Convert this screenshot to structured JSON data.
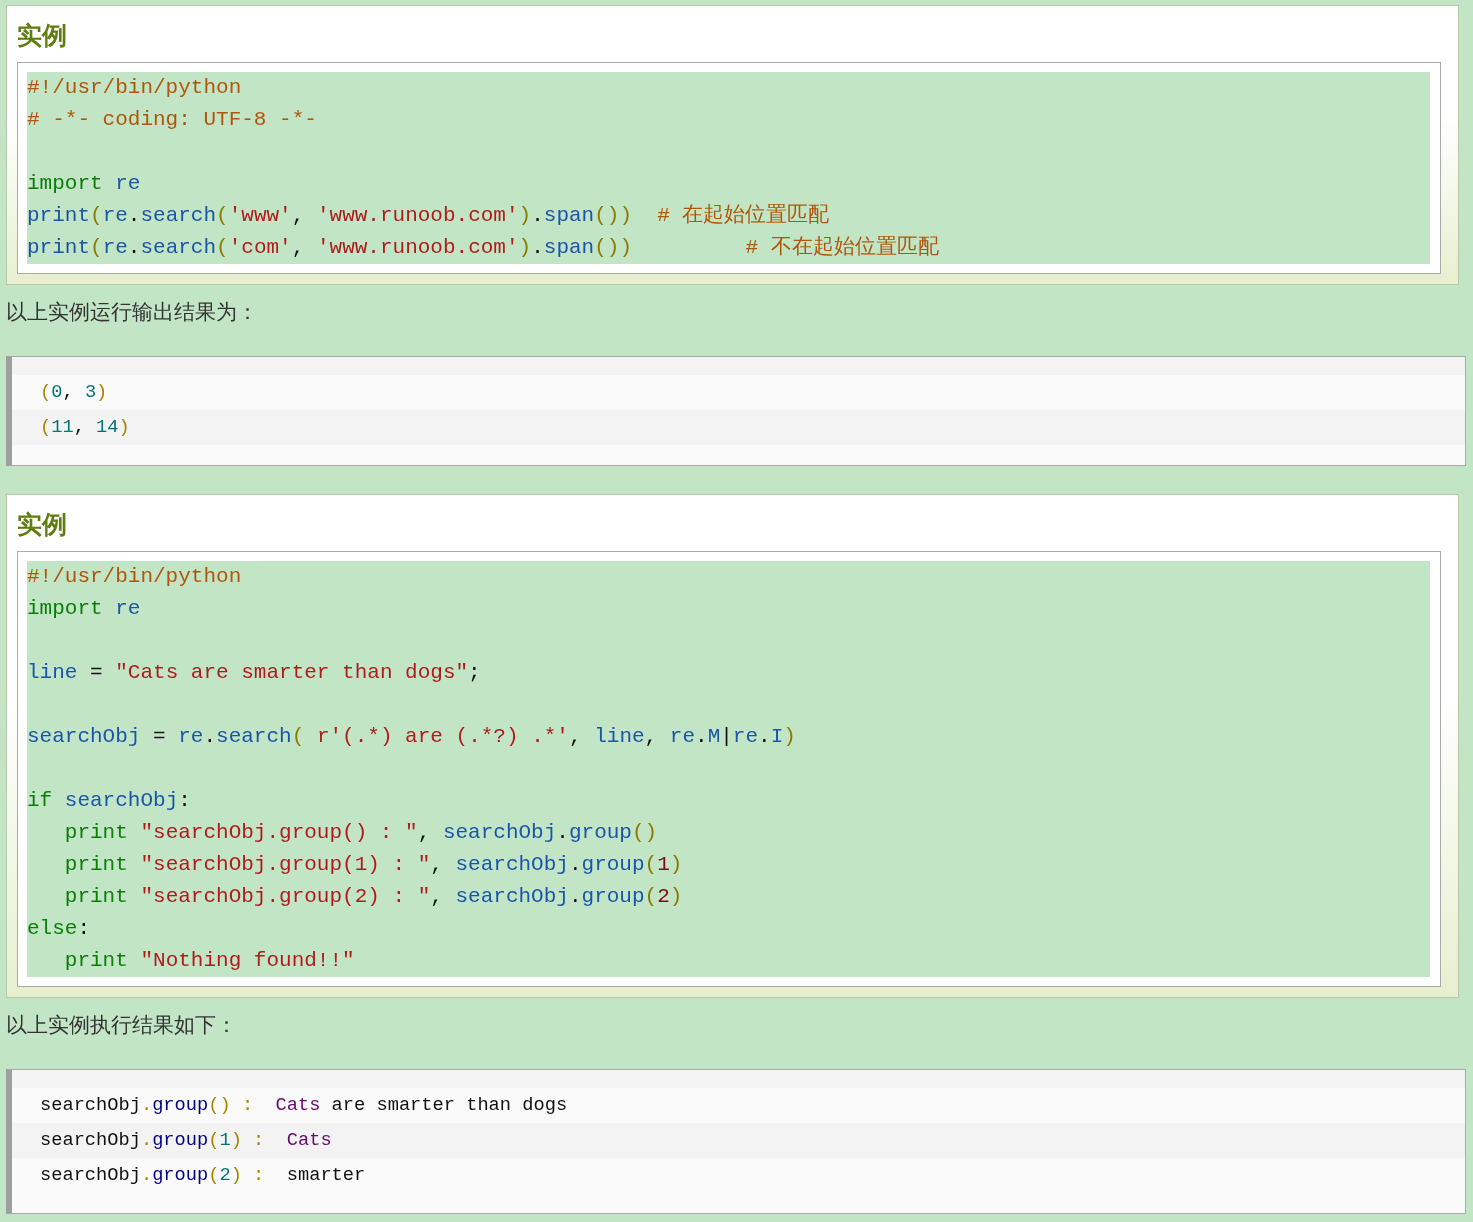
{
  "sections": [
    {
      "kind": "example",
      "title": "实例",
      "lines": [
        {
          "kind": "code",
          "tokens": [
            {
              "kind": "comment",
              "text": "#!/usr/bin/python"
            }
          ]
        },
        {
          "kind": "code",
          "tokens": [
            {
              "kind": "comment",
              "text": "# -*- coding: UTF-8 -*-"
            }
          ]
        },
        {
          "kind": "blank"
        },
        {
          "kind": "code",
          "tokens": [
            {
              "kind": "keyword",
              "text": "import "
            },
            {
              "kind": "name",
              "text": "re"
            }
          ]
        },
        {
          "kind": "code",
          "tokens": [
            {
              "kind": "name",
              "text": "print"
            },
            {
              "kind": "paren",
              "text": "("
            },
            {
              "kind": "name",
              "text": "re"
            },
            {
              "kind": "plain",
              "text": "."
            },
            {
              "kind": "name",
              "text": "search"
            },
            {
              "kind": "paren",
              "text": "("
            },
            {
              "kind": "string",
              "text": "'www'"
            },
            {
              "kind": "plain",
              "text": ", "
            },
            {
              "kind": "string",
              "text": "'www.runoob.com'"
            },
            {
              "kind": "paren",
              "text": ")"
            },
            {
              "kind": "plain",
              "text": "."
            },
            {
              "kind": "name",
              "text": "span"
            },
            {
              "kind": "paren",
              "text": "())  "
            },
            {
              "kind": "comment",
              "text": "# 在起始位置匹配"
            }
          ]
        },
        {
          "kind": "code",
          "tokens": [
            {
              "kind": "name",
              "text": "print"
            },
            {
              "kind": "paren",
              "text": "("
            },
            {
              "kind": "name",
              "text": "re"
            },
            {
              "kind": "plain",
              "text": "."
            },
            {
              "kind": "name",
              "text": "search"
            },
            {
              "kind": "paren",
              "text": "("
            },
            {
              "kind": "string",
              "text": "'com'"
            },
            {
              "kind": "plain",
              "text": ", "
            },
            {
              "kind": "string",
              "text": "'www.runoob.com'"
            },
            {
              "kind": "paren",
              "text": ")"
            },
            {
              "kind": "plain",
              "text": "."
            },
            {
              "kind": "name",
              "text": "span"
            },
            {
              "kind": "paren",
              "text": "())         "
            },
            {
              "kind": "comment",
              "text": "# 不在起始位置匹配"
            }
          ]
        }
      ]
    },
    {
      "kind": "text",
      "text": "以上实例运行输出结果为："
    },
    {
      "kind": "output",
      "lines": [
        {
          "kind": "code",
          "tokens": [
            {
              "kind": "paren",
              "text": "("
            },
            {
              "kind": "number",
              "text": "0"
            },
            {
              "kind": "plain",
              "text": ", "
            },
            {
              "kind": "number",
              "text": "3"
            },
            {
              "kind": "paren",
              "text": ")"
            }
          ]
        },
        {
          "kind": "code",
          "tokens": [
            {
              "kind": "paren",
              "text": "("
            },
            {
              "kind": "number",
              "text": "11"
            },
            {
              "kind": "plain",
              "text": ", "
            },
            {
              "kind": "number",
              "text": "14"
            },
            {
              "kind": "paren",
              "text": ")"
            }
          ]
        }
      ]
    },
    {
      "kind": "example",
      "title": "实例",
      "lines": [
        {
          "kind": "code",
          "tokens": [
            {
              "kind": "comment",
              "text": "#!/usr/bin/python"
            }
          ]
        },
        {
          "kind": "code",
          "tokens": [
            {
              "kind": "keyword",
              "text": "import "
            },
            {
              "kind": "name",
              "text": "re"
            }
          ]
        },
        {
          "kind": "blank"
        },
        {
          "kind": "code",
          "tokens": [
            {
              "kind": "name",
              "text": "line"
            },
            {
              "kind": "plain",
              "text": " = "
            },
            {
              "kind": "string",
              "text": "\"Cats are smarter than dogs\""
            },
            {
              "kind": "plain",
              "text": ";"
            }
          ]
        },
        {
          "kind": "blank"
        },
        {
          "kind": "code",
          "tokens": [
            {
              "kind": "name",
              "text": "searchObj"
            },
            {
              "kind": "plain",
              "text": " = "
            },
            {
              "kind": "name",
              "text": "re"
            },
            {
              "kind": "plain",
              "text": "."
            },
            {
              "kind": "name",
              "text": "search"
            },
            {
              "kind": "paren",
              "text": "( "
            },
            {
              "kind": "string",
              "text": "r'(.*) are (.*?) .*'"
            },
            {
              "kind": "plain",
              "text": ", "
            },
            {
              "kind": "name",
              "text": "line"
            },
            {
              "kind": "plain",
              "text": ", "
            },
            {
              "kind": "name",
              "text": "re"
            },
            {
              "kind": "plain",
              "text": "."
            },
            {
              "kind": "name",
              "text": "M"
            },
            {
              "kind": "plain",
              "text": "|"
            },
            {
              "kind": "name",
              "text": "re"
            },
            {
              "kind": "plain",
              "text": "."
            },
            {
              "kind": "name",
              "text": "I"
            },
            {
              "kind": "paren",
              "text": ")"
            }
          ]
        },
        {
          "kind": "blank"
        },
        {
          "kind": "code",
          "tokens": [
            {
              "kind": "keyword",
              "text": "if "
            },
            {
              "kind": "name",
              "text": "searchObj"
            },
            {
              "kind": "plain",
              "text": ":"
            }
          ]
        },
        {
          "kind": "code",
          "tokens": [
            {
              "kind": "keyword",
              "text": "   print "
            },
            {
              "kind": "string",
              "text": "\"searchObj.group() : \""
            },
            {
              "kind": "plain",
              "text": ", "
            },
            {
              "kind": "name",
              "text": "searchObj"
            },
            {
              "kind": "plain",
              "text": "."
            },
            {
              "kind": "name",
              "text": "group"
            },
            {
              "kind": "paren",
              "text": "()"
            }
          ]
        },
        {
          "kind": "code",
          "tokens": [
            {
              "kind": "keyword",
              "text": "   print "
            },
            {
              "kind": "string",
              "text": "\"searchObj.group(1) : \""
            },
            {
              "kind": "plain",
              "text": ", "
            },
            {
              "kind": "name",
              "text": "searchObj"
            },
            {
              "kind": "plain",
              "text": "."
            },
            {
              "kind": "name",
              "text": "group"
            },
            {
              "kind": "paren",
              "text": "("
            },
            {
              "kind": "number",
              "text": "1"
            },
            {
              "kind": "paren",
              "text": ")"
            }
          ]
        },
        {
          "kind": "code",
          "tokens": [
            {
              "kind": "keyword",
              "text": "   print "
            },
            {
              "kind": "string",
              "text": "\"searchObj.group(2) : \""
            },
            {
              "kind": "plain",
              "text": ", "
            },
            {
              "kind": "name",
              "text": "searchObj"
            },
            {
              "kind": "plain",
              "text": "."
            },
            {
              "kind": "name",
              "text": "group"
            },
            {
              "kind": "paren",
              "text": "("
            },
            {
              "kind": "number",
              "text": "2"
            },
            {
              "kind": "paren",
              "text": ")"
            }
          ]
        },
        {
          "kind": "code",
          "tokens": [
            {
              "kind": "keyword",
              "text": "else"
            },
            {
              "kind": "plain",
              "text": ":"
            }
          ]
        },
        {
          "kind": "code",
          "tokens": [
            {
              "kind": "keyword",
              "text": "   print "
            },
            {
              "kind": "string",
              "text": "\"Nothing found!!\""
            }
          ]
        }
      ]
    },
    {
      "kind": "text",
      "text": "以上实例执行结果如下："
    },
    {
      "kind": "output",
      "lines": [
        {
          "kind": "code",
          "tokens": [
            {
              "kind": "plain",
              "text": "searchObj"
            },
            {
              "kind": "paren",
              "text": "."
            },
            {
              "kind": "name",
              "text": "group"
            },
            {
              "kind": "paren",
              "text": "() :  "
            },
            {
              "kind": "string",
              "text": "Cats"
            },
            {
              "kind": "plain",
              "text": " are smarter than dogs"
            }
          ]
        },
        {
          "kind": "code",
          "tokens": [
            {
              "kind": "plain",
              "text": "searchObj"
            },
            {
              "kind": "paren",
              "text": "."
            },
            {
              "kind": "name",
              "text": "group"
            },
            {
              "kind": "paren",
              "text": "("
            },
            {
              "kind": "number",
              "text": "1"
            },
            {
              "kind": "paren",
              "text": ") :  "
            },
            {
              "kind": "string",
              "text": "Cats"
            }
          ]
        },
        {
          "kind": "code",
          "tokens": [
            {
              "kind": "plain",
              "text": "searchObj"
            },
            {
              "kind": "paren",
              "text": "."
            },
            {
              "kind": "name",
              "text": "group"
            },
            {
              "kind": "paren",
              "text": "("
            },
            {
              "kind": "number",
              "text": "2"
            },
            {
              "kind": "paren",
              "text": ") :  "
            },
            {
              "kind": "plain",
              "text": "smarter"
            }
          ]
        }
      ]
    }
  ]
}
